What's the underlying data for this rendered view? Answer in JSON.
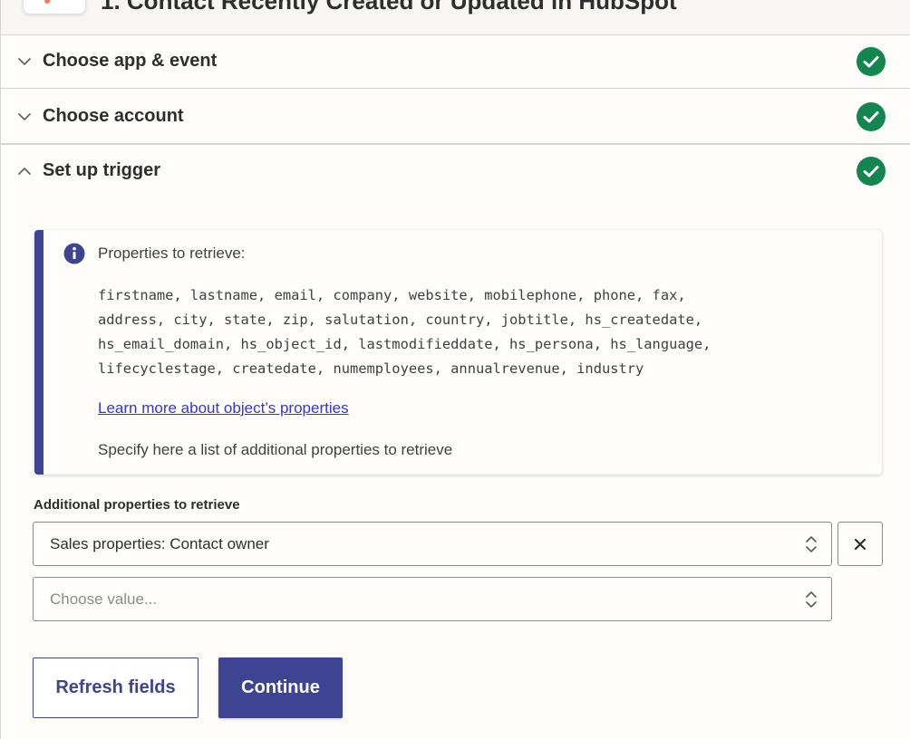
{
  "header": {
    "step_title": "1. Contact Recently Created or Updated in HubSpot",
    "app_icon": "hubspot-logo"
  },
  "sections": [
    {
      "label": "Choose app & event",
      "expanded": false,
      "status": "complete"
    },
    {
      "label": "Choose account",
      "expanded": false,
      "status": "complete"
    },
    {
      "label": "Set up trigger",
      "expanded": true,
      "status": "complete"
    }
  ],
  "info_panel": {
    "icon": "info-icon",
    "heading": "Properties to retrieve:",
    "properties_lines": [
      "firstname, lastname, email, company, website, mobilephone, phone, fax,",
      "address, city, state, zip, salutation, country, jobtitle, hs_createdate,",
      "hs_email_domain, hs_object_id, lastmodifieddate, hs_persona, hs_language,",
      "lifecyclestage, createdate, numemployees, annualrevenue, industry"
    ],
    "link_text": "Learn more about object’s properties",
    "description": "Specify here a list of additional properties to retrieve"
  },
  "additional_properties": {
    "label": "Additional properties to retrieve",
    "selected_value": "Sales properties: Contact owner",
    "empty_placeholder": "Choose value..."
  },
  "buttons": {
    "refresh": "Refresh fields",
    "continue": "Continue"
  },
  "colors": {
    "accent": "#3d4592",
    "success": "#13854e",
    "link": "#3533d6",
    "background": "#fffdf9"
  }
}
